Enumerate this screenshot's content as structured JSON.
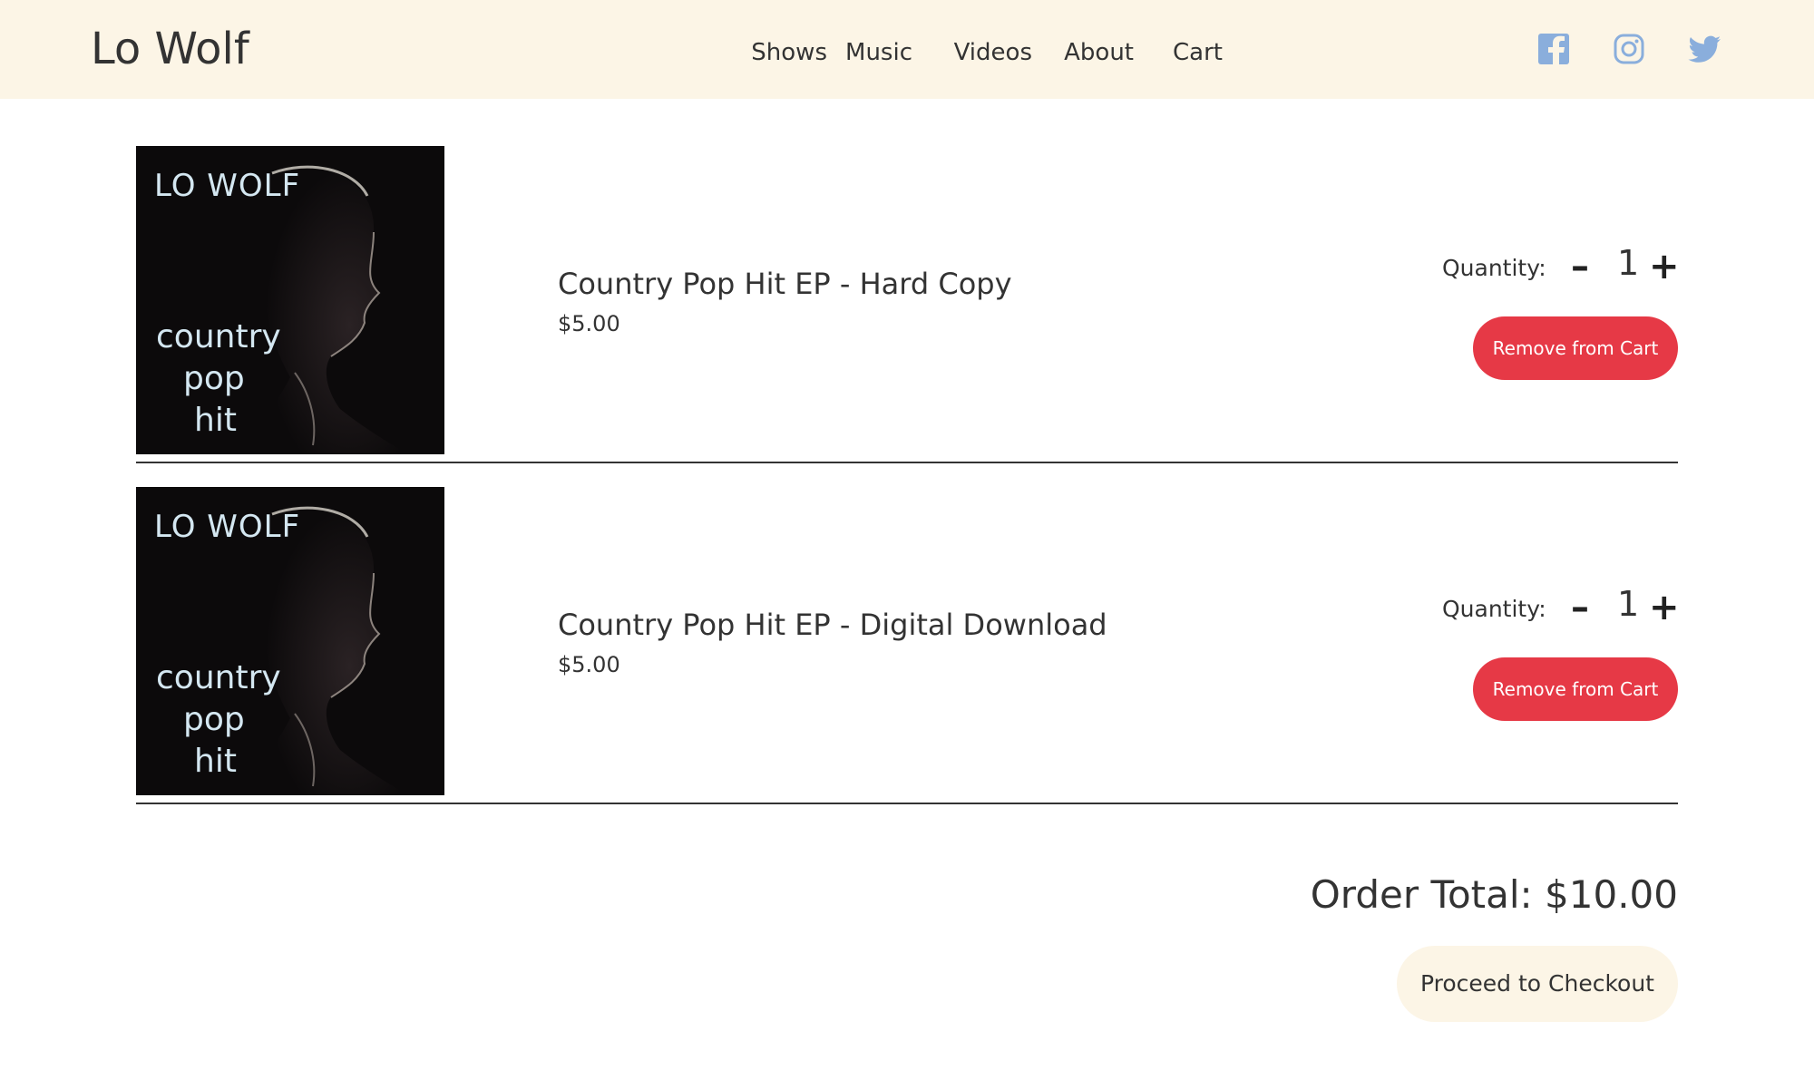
{
  "header": {
    "brand": "Lo Wolf",
    "nav": [
      {
        "label": "Shows"
      },
      {
        "label": "Music"
      },
      {
        "label": "Videos"
      },
      {
        "label": "About"
      },
      {
        "label": "Cart"
      }
    ],
    "social": [
      {
        "icon": "facebook-icon",
        "color": "#8aaedc"
      },
      {
        "icon": "instagram-icon",
        "color": "#8aaedc"
      },
      {
        "icon": "twitter-icon",
        "color": "#8aaedc"
      }
    ]
  },
  "cart": {
    "items": [
      {
        "name": "Country Pop Hit EP - Hard Copy",
        "price": "$5.00",
        "quantity_label": "Quantity:",
        "quantity": "1",
        "remove_label": "Remove from Cart",
        "cover": {
          "title": "LO WOLF",
          "line1": "country",
          "line2": "pop",
          "line3": "hit"
        }
      },
      {
        "name": "Country Pop Hit EP - Digital Download",
        "price": "$5.00",
        "quantity_label": "Quantity:",
        "quantity": "1",
        "remove_label": "Remove from Cart",
        "cover": {
          "title": "LO WOLF",
          "line1": "country",
          "line2": "pop",
          "line3": "hit"
        }
      }
    ],
    "order_total": "Order Total: $10.00",
    "checkout_label": "Proceed to Checkout"
  },
  "colors": {
    "header_bg": "#fcf5e6",
    "remove_button": "#e63946",
    "checkout_bg": "#fcf5e6",
    "social_icon": "#8aaedc"
  }
}
